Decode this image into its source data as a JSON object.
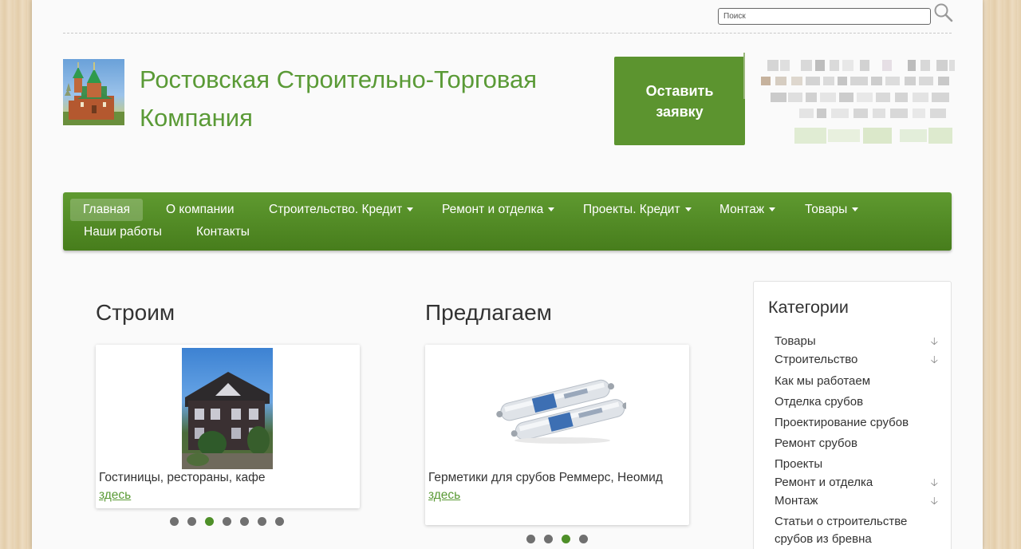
{
  "search": {
    "placeholder": "Поиск"
  },
  "header": {
    "title": "Ростовская Строительно-Торговая Компания",
    "cta_label": "Оставить заявку",
    "accent_color": "#5c942f"
  },
  "nav": {
    "items": [
      {
        "label": "Главная",
        "dropdown": false,
        "active": true
      },
      {
        "label": "О компании",
        "dropdown": false
      },
      {
        "label": "Строительство. Кредит",
        "dropdown": true
      },
      {
        "label": "Ремонт и отделка",
        "dropdown": true
      },
      {
        "label": "Проекты. Кредит",
        "dropdown": true
      },
      {
        "label": "Монтаж",
        "dropdown": true
      },
      {
        "label": "Товары",
        "dropdown": true
      },
      {
        "label": "Наши работы",
        "dropdown": false
      },
      {
        "label": "Контакты",
        "dropdown": false
      }
    ]
  },
  "build": {
    "title": "Строим",
    "caption": "Гостиницы, рестораны, кафе",
    "link": "здесь",
    "dots_total": 7,
    "dots_active": 3
  },
  "offer": {
    "title": "Предлагаем",
    "caption": "Герметики для срубов Реммерс, Неомид",
    "link": "здесь",
    "dots_total": 4,
    "dots_active": 3
  },
  "sidebar": {
    "title": "Категории",
    "items": [
      {
        "label": "Товары",
        "expandable": true
      },
      {
        "label": "Строительство",
        "expandable": true
      },
      {
        "label": "Как мы работаем",
        "expandable": false
      },
      {
        "label": "Отделка срубов",
        "expandable": false
      },
      {
        "label": "Проектирование срубов",
        "expandable": false
      },
      {
        "label": "Ремонт срубов",
        "expandable": false
      },
      {
        "label": "Проекты",
        "expandable": false
      },
      {
        "label": "Ремонт и отделка",
        "expandable": true
      },
      {
        "label": "Монтаж",
        "expandable": true
      },
      {
        "label": "Статьи о строительстве срубов из бревна",
        "expandable": false
      }
    ]
  }
}
